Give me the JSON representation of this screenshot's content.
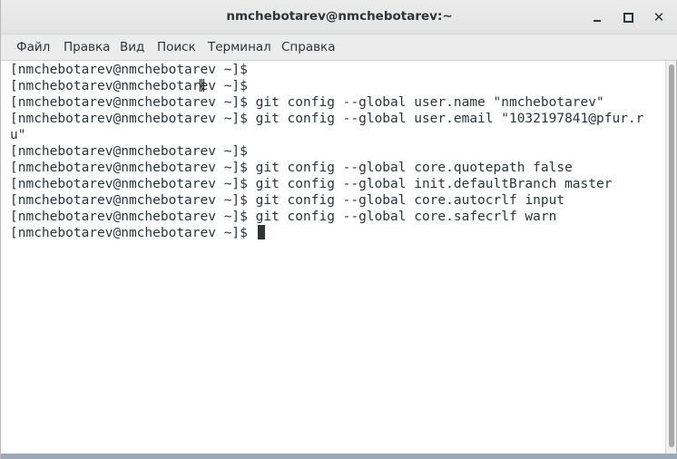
{
  "window": {
    "title": "nmchebotarev@nmchebotarev:~",
    "controls": {
      "minimize_icon": "minimize-icon",
      "maximize_icon": "maximize-icon",
      "close_icon": "close-icon",
      "close_glyph": "✕"
    }
  },
  "menu": {
    "items": [
      "Файл",
      "Правка",
      "Вид",
      "Поиск",
      "Терминал",
      "Справка"
    ]
  },
  "terminal": {
    "lines": [
      "[nmchebotarev@nmchebotarev ~]$",
      "[nmchebotarev@nmchebotarev ~]$",
      "[nmchebotarev@nmchebotarev ~]$ git config --global user.name \"nmchebotarev\"",
      "[nmchebotarev@nmchebotarev ~]$ git config --global user.email \"1032197841@pfur.r",
      "u\"",
      "[nmchebotarev@nmchebotarev ~]$",
      "[nmchebotarev@nmchebotarev ~]$ git config --global core.quotepath false",
      "[nmchebotarev@nmchebotarev ~]$ git config --global init.defaultBranch master",
      "[nmchebotarev@nmchebotarev ~]$ git config --global core.autocrlf input",
      "[nmchebotarev@nmchebotarev ~]$ git config --global core.safecrlf warn",
      "[nmchebotarev@nmchebotarev ~]$ "
    ]
  },
  "colors": {
    "text": "#2e3436",
    "background": "#ffffff",
    "titlebar": "#e8e8e8",
    "menubar": "#ececec"
  }
}
